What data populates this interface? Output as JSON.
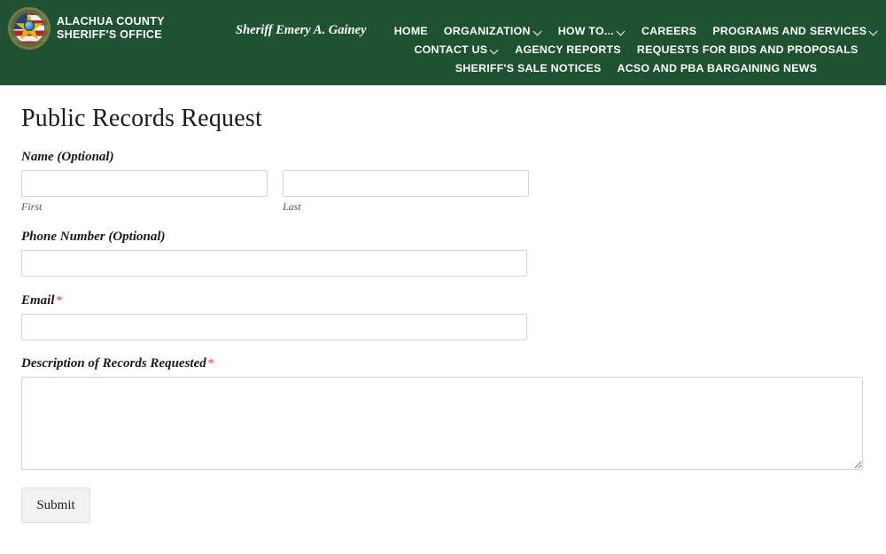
{
  "header": {
    "brand_title": "ALACHUA COUNTY SHERIFF'S OFFICE",
    "sheriff_name": "Sheriff Emery A. Gainey",
    "background_color": "#1f5133",
    "logo_icon": "sheriff-badge-seal-icon",
    "nav_rows": [
      [
        {
          "label": "HOME",
          "has_caret": false
        },
        {
          "label": "ORGANIZATION",
          "has_caret": true
        },
        {
          "label": "HOW TO...",
          "has_caret": true
        },
        {
          "label": "CAREERS",
          "has_caret": false
        },
        {
          "label": "PROGRAMS AND SERVICES",
          "has_caret": true
        }
      ],
      [
        {
          "label": "CONTACT US",
          "has_caret": true
        },
        {
          "label": "AGENCY REPORTS",
          "has_caret": false
        },
        {
          "label": "REQUESTS FOR BIDS AND PROPOSALS",
          "has_caret": false
        }
      ],
      [
        {
          "label": "SHERIFF'S SALE NOTICES",
          "has_caret": false
        },
        {
          "label": "ACSO AND PBA BARGAINING NEWS",
          "has_caret": false
        }
      ]
    ]
  },
  "main": {
    "page_title": "Public Records Request",
    "required_marker": "*",
    "required_marker_color": "#c0392b",
    "fields": {
      "name": {
        "label": "Name (Optional)",
        "first": {
          "sub_label": "First",
          "value": "",
          "placeholder": ""
        },
        "last": {
          "sub_label": "Last",
          "value": "",
          "placeholder": ""
        }
      },
      "phone": {
        "label": "Phone Number (Optional)",
        "value": "",
        "placeholder": ""
      },
      "email": {
        "label": "Email",
        "required": true,
        "value": "",
        "placeholder": ""
      },
      "description": {
        "label": "Description of Records Requested",
        "required": true,
        "value": "",
        "placeholder": ""
      }
    },
    "submit_label": "Submit"
  }
}
